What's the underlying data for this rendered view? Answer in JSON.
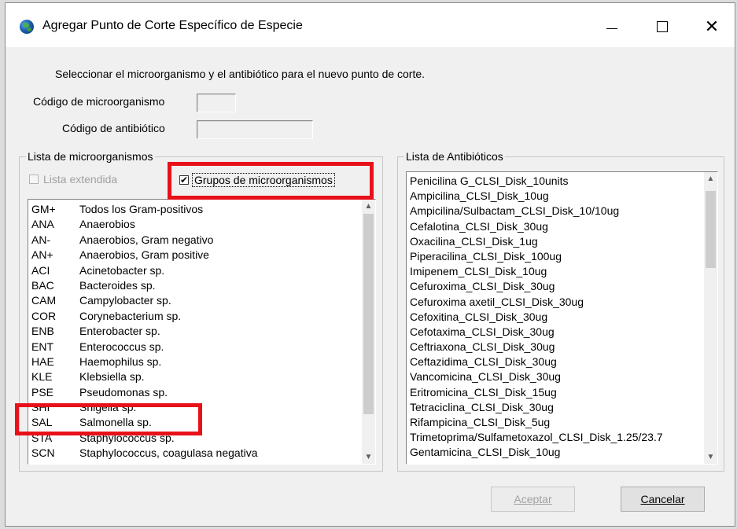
{
  "window": {
    "title": "Agregar Punto de Corte Específico de Especie"
  },
  "form": {
    "instruction": "Seleccionar el microorganismo y el antibiótico para el nuevo punto de corte.",
    "organism_code_label": "Código de microorganismo",
    "organism_code_value": "",
    "antibiotic_code_label": "Código de antibiótico",
    "antibiotic_code_value": ""
  },
  "organisms": {
    "group_label": "Lista de microorganismos",
    "extended_list_label": "Lista extendida",
    "extended_list_checked": false,
    "groups_label": "Grupos de microorganismos",
    "groups_checked": true,
    "items": [
      {
        "code": "GM+",
        "name": "Todos los Gram-positivos"
      },
      {
        "code": "ANA",
        "name": "Anaerobios"
      },
      {
        "code": "AN-",
        "name": "Anaerobios, Gram negativo"
      },
      {
        "code": "AN+",
        "name": "Anaerobios, Gram positive"
      },
      {
        "code": "ACI",
        "name": "Acinetobacter sp."
      },
      {
        "code": "BAC",
        "name": "Bacteroides sp."
      },
      {
        "code": "CAM",
        "name": "Campylobacter sp."
      },
      {
        "code": "COR",
        "name": "Corynebacterium sp."
      },
      {
        "code": "ENB",
        "name": "Enterobacter sp."
      },
      {
        "code": "ENT",
        "name": "Enterococcus sp."
      },
      {
        "code": "HAE",
        "name": "Haemophilus sp."
      },
      {
        "code": "KLE",
        "name": "Klebsiella sp."
      },
      {
        "code": "PSE",
        "name": "Pseudomonas sp."
      },
      {
        "code": "SHI",
        "name": "Shigella sp."
      },
      {
        "code": "SAL",
        "name": "Salmonella sp."
      },
      {
        "code": "STA",
        "name": "Staphylococcus sp."
      },
      {
        "code": "SCN",
        "name": "Staphylococcus, coagulasa negativa"
      }
    ]
  },
  "antibiotics": {
    "group_label": "Lista de Antibióticos",
    "items": [
      "Penicilina G_CLSI_Disk_10units",
      "Ampicilina_CLSI_Disk_10ug",
      "Ampicilina/Sulbactam_CLSI_Disk_10/10ug",
      "Cefalotina_CLSI_Disk_30ug",
      "Oxacilina_CLSI_Disk_1ug",
      "Piperacilina_CLSI_Disk_100ug",
      "Imipenem_CLSI_Disk_10ug",
      "Cefuroxima_CLSI_Disk_30ug",
      "Cefuroxima axetil_CLSI_Disk_30ug",
      "Cefoxitina_CLSI_Disk_30ug",
      "Cefotaxima_CLSI_Disk_30ug",
      "Ceftriaxona_CLSI_Disk_30ug",
      "Ceftazidima_CLSI_Disk_30ug",
      "Vancomicina_CLSI_Disk_30ug",
      "Eritromicina_CLSI_Disk_15ug",
      "Tetraciclina_CLSI_Disk_30ug",
      "Rifampicina_CLSI_Disk_5ug",
      "Trimetoprima/Sulfametoxazol_CLSI_Disk_1.25/23.7",
      "Gentamicina_CLSI_Disk_10ug"
    ]
  },
  "buttons": {
    "accept": "Aceptar",
    "cancel": "Cancelar"
  },
  "colors": {
    "highlight": "#e8111a",
    "dialog_bg": "#f0f0f0"
  }
}
